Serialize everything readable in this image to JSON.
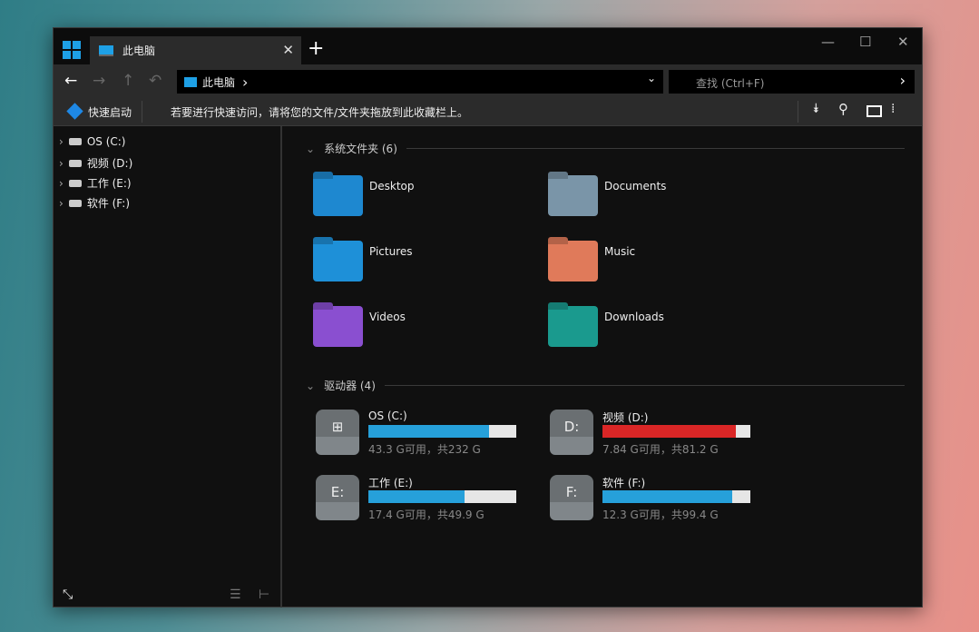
{
  "tab": {
    "title": "此电脑",
    "close": "✕",
    "new": "+"
  },
  "window_controls": {
    "minimize": "—",
    "maximize": "☐",
    "close": "✕"
  },
  "address": {
    "path": "此电脑",
    "chevron": "›",
    "dropdown": "⌄"
  },
  "search": {
    "placeholder": "查找 (Ctrl+F)",
    "go": "›"
  },
  "bar": {
    "quick_launch": "快速启动",
    "hint": "若要进行快速访问，请将您的文件/文件夹拖放到此收藏栏上。"
  },
  "tree": [
    {
      "label": "OS (C:)"
    },
    {
      "label": "视频 (D:)"
    },
    {
      "label": "工作 (E:)"
    },
    {
      "label": "软件 (F:)"
    }
  ],
  "sections": {
    "folders": "系统文件夹 (6)",
    "drives": "驱动器 (4)"
  },
  "folders": [
    {
      "name": "Desktop",
      "color": "#1e88d0"
    },
    {
      "name": "Documents",
      "color": "#7a95a8"
    },
    {
      "name": "Pictures",
      "color": "#1e90d8"
    },
    {
      "name": "Music",
      "color": "#e07a5a"
    },
    {
      "name": "Videos",
      "color": "#8a4fd0"
    },
    {
      "name": "Downloads",
      "color": "#1a9a8e"
    }
  ],
  "drives": [
    {
      "name": "OS (C:)",
      "letter": "⊞",
      "used_fraction": 0.813,
      "info": "43.3 G可用，共232 G",
      "bar_color": "#26a0da"
    },
    {
      "name": "视频 (D:)",
      "letter": "D:",
      "used_fraction": 0.903,
      "info": "7.84 G可用，共81.2 G",
      "bar_color": "#da2626"
    },
    {
      "name": "工作 (E:)",
      "letter": "E:",
      "used_fraction": 0.651,
      "info": "17.4 G可用，共49.9 G",
      "bar_color": "#26a0da"
    },
    {
      "name": "软件 (F:)",
      "letter": "F:",
      "used_fraction": 0.876,
      "info": "12.3 G可用，共99.4 G",
      "bar_color": "#26a0da"
    }
  ]
}
